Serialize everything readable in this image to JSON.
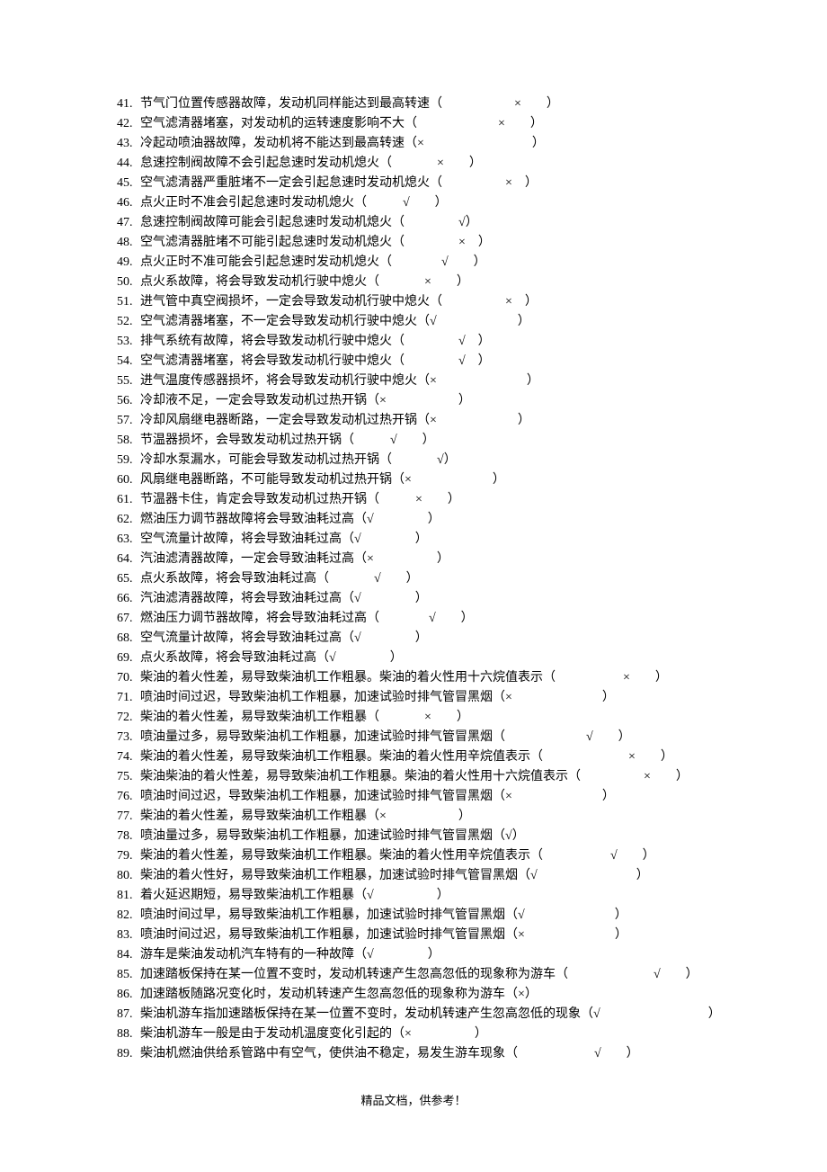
{
  "footer": "精品文档，供参考！",
  "items": [
    {
      "n": "41.",
      "text": "节气门位置传感器故障，发动机同样能达到最高转速（",
      "gap": "80",
      "ans": "×",
      "post": "　　）"
    },
    {
      "n": "42.",
      "text": "空气滤清器堵塞，对发动机的运转速度影响不大（",
      "gap": "90",
      "ans": "×",
      "post": "　　）"
    },
    {
      "n": "43.",
      "text": "冷起动喷油器故障，发动机将不能达到最高转速（×",
      "gap": "120",
      "ans": "",
      "post": "）"
    },
    {
      "n": "44.",
      "text": "怠速控制阀故障不会引起怠速时发动机熄火（",
      "gap": "50",
      "ans": "×",
      "post": "　　）"
    },
    {
      "n": "45.",
      "text": "空气滤清器严重脏堵不一定会引起怠速时发动机熄火（",
      "gap": "70",
      "ans": "×",
      "post": "　）"
    },
    {
      "n": "46.",
      "text": "点火正时不准会引起怠速时发动机熄火（",
      "gap": "40",
      "ans": "√",
      "post": "　　）"
    },
    {
      "n": "47.",
      "text": "怠速控制阀故障可能会引起怠速时发动机熄火（",
      "gap": "60",
      "ans": "√",
      "post": "）"
    },
    {
      "n": "48.",
      "text": "空气滤清器脏堵不可能引起怠速时发动机熄火（",
      "gap": "60",
      "ans": "×",
      "post": "　）"
    },
    {
      "n": "49.",
      "text": "点火正时不准可能会引起怠速时发动机熄火（",
      "gap": "55",
      "ans": "√",
      "post": "　　）"
    },
    {
      "n": "50.",
      "text": "点火系故障，将会导致发动机行驶中熄火（",
      "gap": "50",
      "ans": "×",
      "post": "　　）"
    },
    {
      "n": "51.",
      "text": "进气管中真空阀损坏，一定会导致发动机行驶中熄火（",
      "gap": "70",
      "ans": "×",
      "post": "　）"
    },
    {
      "n": "52.",
      "text": "空气滤清器堵塞，不一定会导致发动机行驶中熄火（√",
      "gap": "90",
      "ans": "",
      "post": "）"
    },
    {
      "n": "53.",
      "text": "排气系统有故障，将会导致发动机行驶中熄火（",
      "gap": "60",
      "ans": "√",
      "post": "　）"
    },
    {
      "n": "54.",
      "text": "空气滤清器堵塞，将会导致发动机行驶中熄火（",
      "gap": "60",
      "ans": "√",
      "post": "　）"
    },
    {
      "n": "55.",
      "text": "进气温度传感器损坏，将会导致发动机行驶中熄火（×",
      "gap": "100",
      "ans": "",
      "post": "）"
    },
    {
      "n": "56.",
      "text": "冷却液不足，一定会导致发动机过热开锅（×",
      "gap": "80",
      "ans": "",
      "post": "）"
    },
    {
      "n": "57.",
      "text": "冷却风扇继电器断路，一定会导致发动机过热开锅（×",
      "gap": "90",
      "ans": "",
      "post": "）"
    },
    {
      "n": "58.",
      "text": "节温器损坏，会导致发动机过热开锅（",
      "gap": "40",
      "ans": "√",
      "post": "　　）"
    },
    {
      "n": "59.",
      "text": "冷却水泵漏水，可能会导致发动机过热开锅（",
      "gap": "50",
      "ans": "√",
      "post": "）"
    },
    {
      "n": "60.",
      "text": "风扇继电器断路，不可能导致发动机过热开锅（×",
      "gap": "90",
      "ans": "",
      "post": "）"
    },
    {
      "n": "61.",
      "text": "节温器卡住，肯定会导致发动机过热开锅（",
      "gap": "40",
      "ans": "×",
      "post": "　　）"
    },
    {
      "n": "62.",
      "text": "燃油压力调节器故障将会导致油耗过高（√",
      "gap": "60",
      "ans": "",
      "post": "）"
    },
    {
      "n": "63.",
      "text": "空气流量计故障，将会导致油耗过高（√",
      "gap": "60",
      "ans": "",
      "post": "）"
    },
    {
      "n": "64.",
      "text": "汽油滤清器故障，一定会导致油耗过高（×",
      "gap": "70",
      "ans": "",
      "post": "）"
    },
    {
      "n": "65.",
      "text": "点火系故障，将会导致油耗过高（",
      "gap": "50",
      "ans": "√",
      "post": "　　）"
    },
    {
      "n": "66.",
      "text": "汽油滤清器故障，将会导致油耗过高（√",
      "gap": "60",
      "ans": "",
      "post": "）"
    },
    {
      "n": "67.",
      "text": "燃油压力调节器故障，将会导致油耗过高（",
      "gap": "55",
      "ans": "√",
      "post": "　　）"
    },
    {
      "n": "68.",
      "text": "空气流量计故障，将会导致油耗过高（√",
      "gap": "60",
      "ans": "",
      "post": "）"
    },
    {
      "n": "69.",
      "text": "点火系故障，将会导致油耗过高（√",
      "gap": "60",
      "ans": "",
      "post": "）"
    },
    {
      "n": "70.",
      "text": "柴油的着火性差，易导致柴油机工作粗暴。柴油的着火性用十六烷值表示（",
      "gap": "75",
      "ans": "×",
      "post": "　　）"
    },
    {
      "n": "71.",
      "text": "喷油时间过迟，导致柴油机工作粗暴，加速试验时排气管冒黑烟（×",
      "gap": "100",
      "ans": "",
      "post": "）"
    },
    {
      "n": "72.",
      "text": "柴油的着火性差，易导致柴油机工作粗暴（",
      "gap": "50",
      "ans": "×",
      "post": "　　）"
    },
    {
      "n": "73.",
      "text": "喷油量过多，易导致柴油机工作粗暴，加速试验时排气管冒黑烟（",
      "gap": "90",
      "ans": "√",
      "post": "　　）"
    },
    {
      "n": "74.",
      "text": "柴油的着火性差，易导致柴油机工作粗暴。柴油的着火性用辛烷值表示（",
      "gap": "95",
      "ans": "×",
      "post": "　　）"
    },
    {
      "n": "75.",
      "text": "柴油柴油的着火性差，易导致柴油机工作粗暴。柴油的着火性用十六烷值表示（",
      "gap": "70",
      "ans": "×",
      "post": "　　）"
    },
    {
      "n": "76.",
      "text": "喷油时间过迟，导致柴油机工作粗暴，加速试验时排气管冒黑烟（×",
      "gap": "100",
      "ans": "",
      "post": "）"
    },
    {
      "n": "77.",
      "text": "柴油的着火性差，易导致柴油机工作粗暴（×",
      "gap": "80",
      "ans": "",
      "post": "）"
    },
    {
      "n": "78.",
      "text": "喷油量过多，易导致柴油机工作粗暴，加速试验时排气管冒黑烟（√",
      "gap": "0",
      "ans": "",
      "post": "）"
    },
    {
      "n": "79.",
      "text": "柴油的着火性差，易导致柴油机工作粗暴。柴油的着火性用辛烷值表示（",
      "gap": "75",
      "ans": "√",
      "post": "　　）"
    },
    {
      "n": "80.",
      "text": "柴油的着火性好，易导致柴油机工作粗暴，加速试验时排气管冒黑烟（√",
      "gap": "110",
      "ans": "",
      "post": "）"
    },
    {
      "n": "81.",
      "text": "着火延迟期短，易导致柴油机工作粗暴（√",
      "gap": "70",
      "ans": "",
      "post": "）"
    },
    {
      "n": "82.",
      "text": "喷油时间过早，易导致柴油机工作粗暴，加速试验时排气管冒黑烟（√",
      "gap": "100",
      "ans": "",
      "post": "）"
    },
    {
      "n": "83.",
      "text": "喷油时间过迟，易导致柴油机工作粗暴，加速试验时排气管冒黑烟（×",
      "gap": "100",
      "ans": "",
      "post": "）"
    },
    {
      "n": "84.",
      "text": "游车是柴油发动机汽车特有的一种故障（√",
      "gap": "60",
      "ans": "",
      "post": "）"
    },
    {
      "n": "85.",
      "text": "加速踏板保持在某一位置不变时，发动机转速产生忽高忽低的现象称为游车（",
      "gap": "95",
      "ans": "√",
      "post": "　　）"
    },
    {
      "n": "86.",
      "text": "加速踏板随路况变化时，发动机转速产生忽高忽低的现象称为游车（×",
      "gap": "0",
      "ans": "",
      "post": "）"
    },
    {
      "n": "87.",
      "text": "柴油机游车指加速踏板保持在某一位置不变时，发动机转速产生忽高忽低的现象（√",
      "gap": "120",
      "ans": "",
      "post": "）"
    },
    {
      "n": "88.",
      "text": "柴油机游车一般是由于发动机温度变化引起的（×",
      "gap": "70",
      "ans": "",
      "post": "）"
    },
    {
      "n": "89.",
      "text": "柴油机燃油供给系管路中有空气，使供油不稳定，易发生游车现象（",
      "gap": "85",
      "ans": "√",
      "post": "　　）"
    }
  ]
}
